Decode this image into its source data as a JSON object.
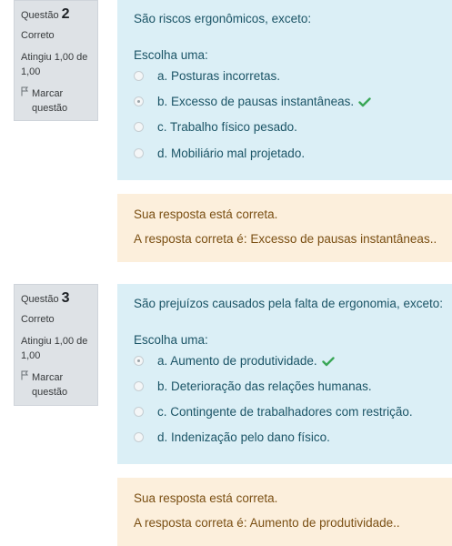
{
  "questions": [
    {
      "info": {
        "label": "Questão",
        "number": "2",
        "state": "Correto",
        "grade": "Atingiu 1,00 de 1,00",
        "flag": "Marcar questão"
      },
      "text": "São riscos ergonômicos, exceto:",
      "prompt": "Escolha uma:",
      "options": [
        {
          "label": "a. Posturas incorretas.",
          "checked": false,
          "correct": false
        },
        {
          "label": "b. Excesso de pausas instantâneas.",
          "checked": true,
          "correct": true
        },
        {
          "label": "c. Trabalho físico pesado.",
          "checked": false,
          "correct": false
        },
        {
          "label": "d. Mobiliário mal projetado.",
          "checked": false,
          "correct": false
        }
      ],
      "feedback": {
        "status": "Sua resposta está correta.",
        "answer": "A resposta correta é: Excesso de pausas instantâneas.."
      }
    },
    {
      "info": {
        "label": "Questão",
        "number": "3",
        "state": "Correto",
        "grade": "Atingiu 1,00 de 1,00",
        "flag": "Marcar questão"
      },
      "text": "São prejuízos causados pela falta de ergonomia, exceto:",
      "prompt": "Escolha uma:",
      "options": [
        {
          "label": "a. Aumento de produtividade.",
          "checked": true,
          "correct": true
        },
        {
          "label": "b. Deterioração das relações humanas.",
          "checked": false,
          "correct": false
        },
        {
          "label": "c. Contingente de trabalhadores com restrição.",
          "checked": false,
          "correct": false
        },
        {
          "label": "d. Indenização pelo dano físico.",
          "checked": false,
          "correct": false
        }
      ],
      "feedback": {
        "status": "Sua resposta está correta.",
        "answer": "A resposta correta é: Aumento de produtividade.."
      }
    }
  ],
  "colors": {
    "info_bg": "#dee2e6",
    "formulation_bg": "#dbeff6",
    "feedback_bg": "#fcefdc",
    "correct_check": "#3aa757"
  }
}
